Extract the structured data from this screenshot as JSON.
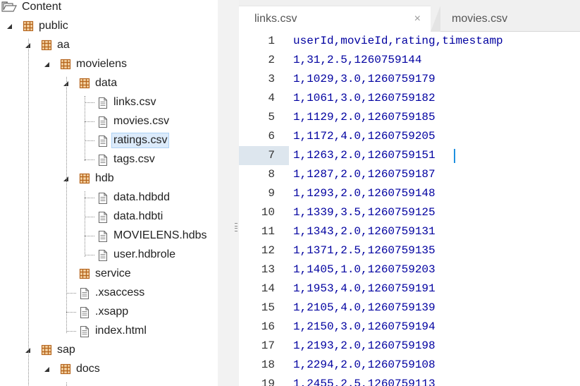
{
  "tree": {
    "root": {
      "label": "Content",
      "icon": "folder-open-icon"
    },
    "nodes": [
      {
        "label": "public",
        "icon": "package-icon"
      },
      {
        "label": "aa",
        "icon": "package-icon"
      },
      {
        "label": "movielens",
        "icon": "package-icon"
      },
      {
        "label": "data",
        "icon": "package-icon"
      },
      {
        "label": "links.csv",
        "icon": "file-icon"
      },
      {
        "label": "movies.csv",
        "icon": "file-icon"
      },
      {
        "label": "ratings.csv",
        "icon": "file-icon",
        "selected": true
      },
      {
        "label": "tags.csv",
        "icon": "file-icon"
      },
      {
        "label": "hdb",
        "icon": "package-icon"
      },
      {
        "label": "data.hdbdd",
        "icon": "file-icon"
      },
      {
        "label": "data.hdbti",
        "icon": "file-icon"
      },
      {
        "label": "MOVIELENS.hdbs",
        "icon": "file-icon"
      },
      {
        "label": "user.hdbrole",
        "icon": "file-icon"
      },
      {
        "label": "service",
        "icon": "package-icon"
      },
      {
        "label": ".xsaccess",
        "icon": "file-icon"
      },
      {
        "label": ".xsapp",
        "icon": "file-icon"
      },
      {
        "label": "index.html",
        "icon": "file-icon"
      },
      {
        "label": "sap",
        "icon": "package-icon"
      },
      {
        "label": "docs",
        "icon": "package-icon"
      }
    ]
  },
  "editor": {
    "tabs": [
      {
        "label": "links.csv",
        "active": true,
        "close": "×"
      },
      {
        "label": "movies.csv",
        "active": false
      }
    ],
    "current_line": 7,
    "lines": [
      {
        "n": "1",
        "text": "userId,movieId,rating,timestamp"
      },
      {
        "n": "2",
        "text": "1,31,2.5,1260759144"
      },
      {
        "n": "3",
        "text": "1,1029,3.0,1260759179"
      },
      {
        "n": "4",
        "text": "1,1061,3.0,1260759182"
      },
      {
        "n": "5",
        "text": "1,1129,2.0,1260759185"
      },
      {
        "n": "6",
        "text": "1,1172,4.0,1260759205"
      },
      {
        "n": "7",
        "text": "1,1263,2.0,1260759151"
      },
      {
        "n": "8",
        "text": "1,1287,2.0,1260759187"
      },
      {
        "n": "9",
        "text": "1,1293,2.0,1260759148"
      },
      {
        "n": "10",
        "text": "1,1339,3.5,1260759125"
      },
      {
        "n": "11",
        "text": "1,1343,2.0,1260759131"
      },
      {
        "n": "12",
        "text": "1,1371,2.5,1260759135"
      },
      {
        "n": "13",
        "text": "1,1405,1.0,1260759203"
      },
      {
        "n": "14",
        "text": "1,1953,4.0,1260759191"
      },
      {
        "n": "15",
        "text": "1,2105,4.0,1260759139"
      },
      {
        "n": "16",
        "text": "1,2150,3.0,1260759194"
      },
      {
        "n": "17",
        "text": "1,2193,2.0,1260759198"
      },
      {
        "n": "18",
        "text": "1,2294,2.0,1260759108"
      },
      {
        "n": "19",
        "text": "1,2455,2.5,1260759113"
      }
    ]
  },
  "colors": {
    "code_text": "#0000a0",
    "selection_bg": "#dcebfb",
    "caret": "#1e90e0",
    "package_icon": "#b5651d"
  }
}
